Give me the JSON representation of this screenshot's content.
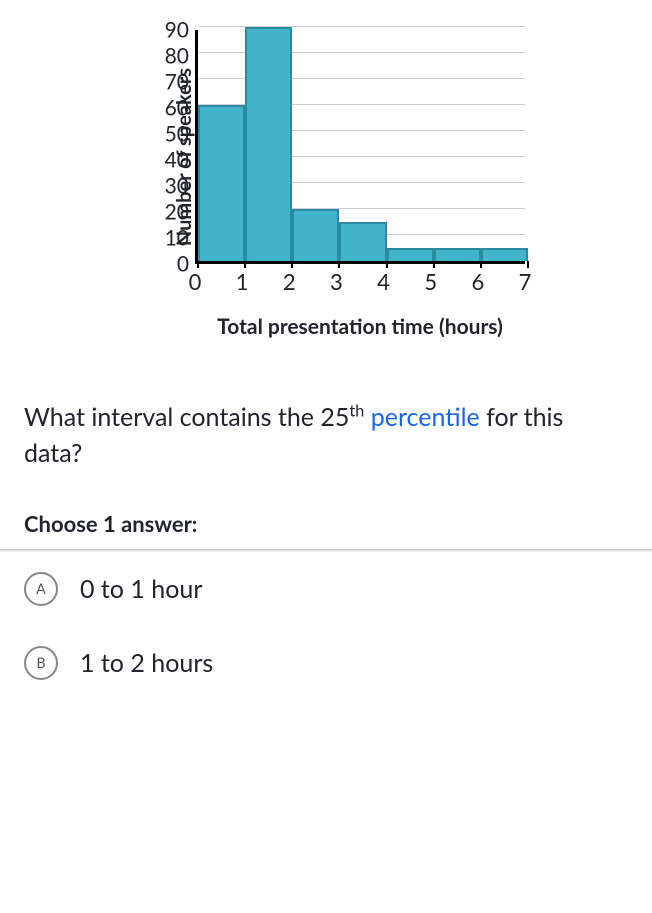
{
  "chart_data": {
    "type": "bar",
    "categories": [
      0,
      1,
      2,
      3,
      4,
      5,
      6,
      7
    ],
    "values": [
      60,
      90,
      20,
      15,
      5,
      5,
      5
    ],
    "title": "",
    "xlabel": "Total presentation time (hours)",
    "ylabel": "Number of speakers",
    "ylim": [
      0,
      90
    ],
    "y_ticks": [
      0,
      10,
      20,
      30,
      40,
      50,
      60,
      70,
      80,
      90
    ]
  },
  "question": {
    "prefix": "What interval contains the ",
    "value_base": "25",
    "value_sup": "th",
    "link_word": " percentile",
    "suffix": " for this data?"
  },
  "choose_label": "Choose 1 answer:",
  "answers": [
    {
      "letter": "A",
      "text": "0 to 1 hour"
    },
    {
      "letter": "B",
      "text": "1 to 2 hours"
    }
  ]
}
